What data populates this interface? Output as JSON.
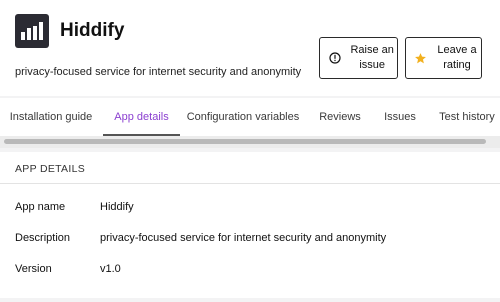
{
  "app": {
    "name": "Hiddify",
    "tagline": "privacy-focused service for internet security and anonymity",
    "logo_icon": "hiddify-bars-logo"
  },
  "actions": {
    "raise_issue": {
      "label": "Raise an issue",
      "icon": "info-circle-icon"
    },
    "rate": {
      "label": "Leave a rating",
      "icon": "star-icon",
      "icon_color": "#f2b01e"
    }
  },
  "tabs": [
    {
      "label": "Installation guide",
      "active": false
    },
    {
      "label": "App details",
      "active": true
    },
    {
      "label": "Configuration variables",
      "active": false
    },
    {
      "label": "Reviews",
      "active": false
    },
    {
      "label": "Issues",
      "active": false
    },
    {
      "label": "Test history",
      "active": false
    }
  ],
  "colors": {
    "active_tab": "#8b3fd0",
    "logo_bg": "#2b2b33"
  },
  "details": {
    "section_title": "APP DETAILS",
    "rows": [
      {
        "label": "App name",
        "value": "Hiddify"
      },
      {
        "label": "Description",
        "value": "privacy-focused service for internet security and anonymity"
      },
      {
        "label": "Version",
        "value": "v1.0"
      }
    ]
  }
}
